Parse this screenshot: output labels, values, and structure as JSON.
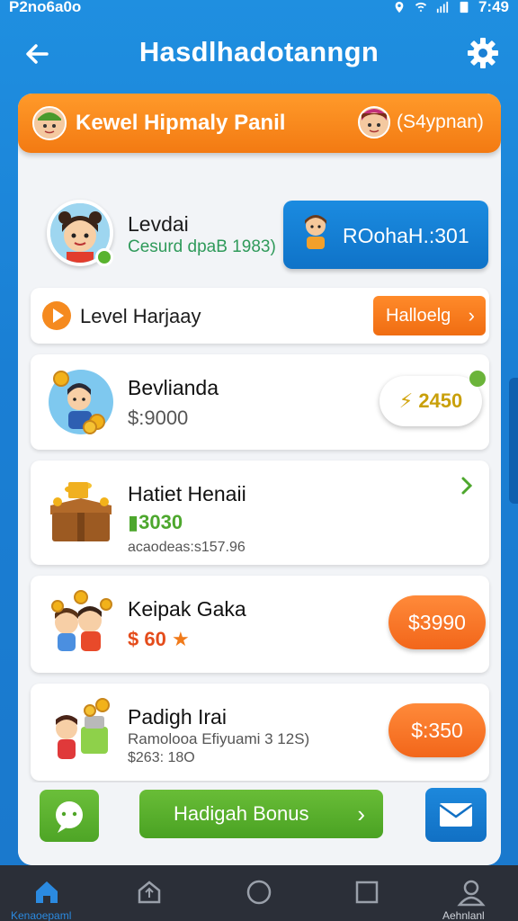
{
  "status_bar": {
    "carrier": "P2no6a0o",
    "time": "7:49"
  },
  "header": {
    "title": "Hasdlhadotanngn",
    "back_icon": "arrow-left-icon",
    "settings_icon": "gear-icon"
  },
  "level_banner": {
    "title": "Kewel Hipmaly Panil",
    "right_text": "(S4ypnan)"
  },
  "profile": {
    "name": "Levdai",
    "subtitle": "Cesurd dpaB 1983)",
    "points_label": "ROohaH.:301"
  },
  "level_row": {
    "label": "Level Harjaay",
    "button_label": "Halloelg",
    "chevron": "›"
  },
  "rewards": [
    {
      "title": "Bevlianda",
      "value": "$:9000",
      "badge": "2450",
      "badge_icon": "coin-icon"
    },
    {
      "title": "Hatiet Henaii",
      "value": "3030",
      "sub": "acaodeas:s157.96",
      "chevron": "›"
    },
    {
      "title": "Keipak Gaka",
      "value": "$ 60",
      "button_label": "$3990"
    },
    {
      "title": "Padigh Irai",
      "sub1": "Ramolooa Efiyuami 3 12S)",
      "sub2": "$263: 18O",
      "button_label": "$:350"
    }
  ],
  "bottom_actions": {
    "bonus_label": "Hadigah Bonus",
    "chevron": "›"
  },
  "nav": {
    "items": [
      {
        "label": "Kenaoepaml",
        "icon": "home-icon"
      },
      {
        "label": "",
        "icon": "house-outline-icon"
      },
      {
        "label": "",
        "icon": "circle-icon"
      },
      {
        "label": "",
        "icon": "square-icon"
      },
      {
        "label": "Aehnlanl",
        "icon": "person-icon"
      }
    ]
  },
  "colors": {
    "primary_blue": "#1a7fd4",
    "orange": "#f37a12",
    "green": "#4ea526",
    "nav_bg": "#2b2f38"
  }
}
